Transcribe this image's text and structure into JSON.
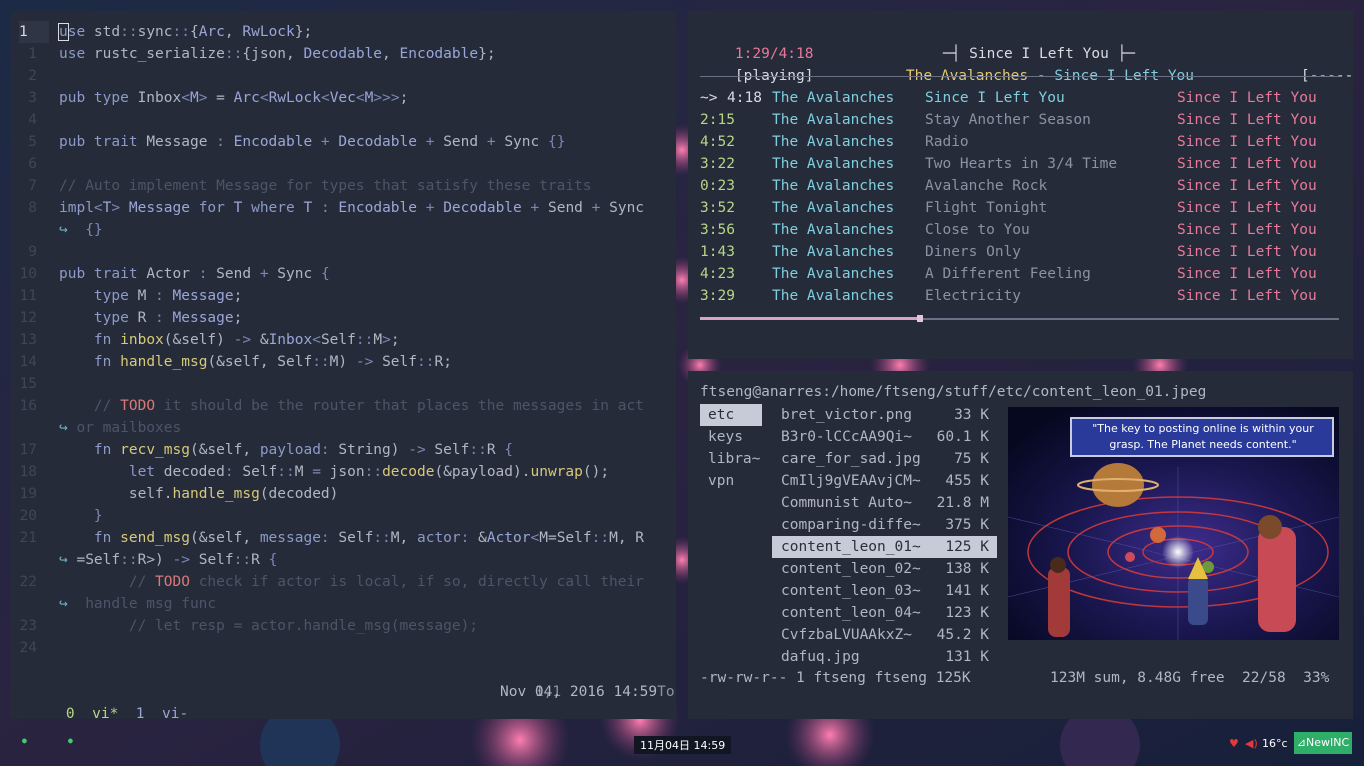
{
  "editor": {
    "lines": [
      {
        "n": "1",
        "segs": [
          [
            "kw",
            "use"
          ],
          [
            "plain",
            " std"
          ],
          [
            "op",
            "::"
          ],
          [
            "plain",
            "sync"
          ],
          [
            "op",
            "::"
          ],
          [
            "plain",
            "{"
          ],
          [
            "ty",
            "Arc"
          ],
          [
            "plain",
            ", "
          ],
          [
            "ty",
            "RwLock"
          ],
          [
            "plain",
            "};"
          ]
        ]
      },
      {
        "n": "1",
        "segs": [
          [
            "kw",
            "use"
          ],
          [
            "plain",
            " rustc_serialize"
          ],
          [
            "op",
            "::"
          ],
          [
            "plain",
            "{json, "
          ],
          [
            "ty",
            "Decodable"
          ],
          [
            "plain",
            ", "
          ],
          [
            "ty",
            "Encodable"
          ],
          [
            "plain",
            "};"
          ]
        ]
      },
      {
        "n": "2",
        "segs": []
      },
      {
        "n": "3",
        "segs": [
          [
            "kw",
            "pub type "
          ],
          [
            "plain",
            "Inbox"
          ],
          [
            "op",
            "<"
          ],
          [
            "ty",
            "M"
          ],
          [
            "op",
            ">"
          ],
          [
            "plain",
            " = "
          ],
          [
            "ty",
            "Arc"
          ],
          [
            "op",
            "<"
          ],
          [
            "ty",
            "RwLock"
          ],
          [
            "op",
            "<"
          ],
          [
            "ty",
            "Vec"
          ],
          [
            "op",
            "<"
          ],
          [
            "ty",
            "M"
          ],
          [
            "op",
            ">>>"
          ],
          [
            "plain",
            ";"
          ]
        ]
      },
      {
        "n": "4",
        "segs": []
      },
      {
        "n": "5",
        "segs": [
          [
            "kw",
            "pub trait "
          ],
          [
            "plain",
            "Message "
          ],
          [
            "op",
            ": "
          ],
          [
            "ty",
            "Encodable"
          ],
          [
            "op",
            " + "
          ],
          [
            "ty",
            "Decodable"
          ],
          [
            "op",
            " + "
          ],
          [
            "plain",
            "Send"
          ],
          [
            "op",
            " + "
          ],
          [
            "plain",
            "Sync "
          ],
          [
            "op",
            "{}"
          ]
        ]
      },
      {
        "n": "6",
        "segs": []
      },
      {
        "n": "7",
        "segs": [
          [
            "cm",
            "// Auto implement Message for types that satisfy these traits"
          ]
        ]
      },
      {
        "n": "8",
        "segs": [
          [
            "kw",
            "impl"
          ],
          [
            "op",
            "<"
          ],
          [
            "ty",
            "T"
          ],
          [
            "op",
            "> "
          ],
          [
            "ty",
            "Message "
          ],
          [
            "kw",
            "for "
          ],
          [
            "ty",
            "T "
          ],
          [
            "kw",
            "where "
          ],
          [
            "ty",
            "T "
          ],
          [
            "op",
            ": "
          ],
          [
            "ty",
            "Encodable"
          ],
          [
            "op",
            " + "
          ],
          [
            "ty",
            "Decodable"
          ],
          [
            "op",
            " + "
          ],
          [
            "plain",
            "Send"
          ],
          [
            "op",
            " + "
          ],
          [
            "plain",
            "Sync"
          ]
        ]
      },
      {
        "n": "",
        "segs": [
          [
            "wrap",
            "↪ "
          ],
          [
            "op",
            " {}"
          ]
        ]
      },
      {
        "n": "9",
        "segs": []
      },
      {
        "n": "10",
        "segs": [
          [
            "kw",
            "pub trait "
          ],
          [
            "plain",
            "Actor "
          ],
          [
            "op",
            ": "
          ],
          [
            "plain",
            "Send"
          ],
          [
            "op",
            " + "
          ],
          [
            "plain",
            "Sync "
          ],
          [
            "op",
            "{"
          ]
        ]
      },
      {
        "n": "11",
        "segs": [
          [
            "plain",
            "    "
          ],
          [
            "kw",
            "type "
          ],
          [
            "plain",
            "M "
          ],
          [
            "op",
            ": "
          ],
          [
            "ty",
            "Message"
          ],
          [
            "plain",
            ";"
          ]
        ]
      },
      {
        "n": "12",
        "segs": [
          [
            "plain",
            "    "
          ],
          [
            "kw",
            "type "
          ],
          [
            "plain",
            "R "
          ],
          [
            "op",
            ": "
          ],
          [
            "ty",
            "Message"
          ],
          [
            "plain",
            ";"
          ]
        ]
      },
      {
        "n": "13",
        "segs": [
          [
            "plain",
            "    "
          ],
          [
            "kw",
            "fn "
          ],
          [
            "fn",
            "inbox"
          ],
          [
            "plain",
            "(&self) "
          ],
          [
            "op",
            "->"
          ],
          [
            "plain",
            " &"
          ],
          [
            "ty",
            "Inbox"
          ],
          [
            "op",
            "<"
          ],
          [
            "plain",
            "Self"
          ],
          [
            "op",
            "::"
          ],
          [
            "plain",
            "M"
          ],
          [
            "op",
            ">"
          ],
          [
            "plain",
            ";"
          ]
        ]
      },
      {
        "n": "14",
        "segs": [
          [
            "plain",
            "    "
          ],
          [
            "kw",
            "fn "
          ],
          [
            "fn",
            "handle_msg"
          ],
          [
            "plain",
            "(&self, Self"
          ],
          [
            "op",
            "::"
          ],
          [
            "plain",
            "M) "
          ],
          [
            "op",
            "->"
          ],
          [
            "plain",
            " Self"
          ],
          [
            "op",
            "::"
          ],
          [
            "plain",
            "R;"
          ]
        ]
      },
      {
        "n": "15",
        "segs": []
      },
      {
        "n": "16",
        "segs": [
          [
            "plain",
            "    "
          ],
          [
            "cm",
            "// "
          ],
          [
            "todo",
            "TODO"
          ],
          [
            "cm",
            " it should be the router that places the messages in act"
          ]
        ]
      },
      {
        "n": "",
        "segs": [
          [
            "wrap",
            "↪ "
          ],
          [
            "cm",
            "or mailboxes"
          ]
        ]
      },
      {
        "n": "17",
        "segs": [
          [
            "plain",
            "    "
          ],
          [
            "kw",
            "fn "
          ],
          [
            "fn",
            "recv_msg"
          ],
          [
            "plain",
            "(&self, "
          ],
          [
            "kw",
            "payload"
          ],
          [
            "op",
            ": "
          ],
          [
            "plain",
            "String) "
          ],
          [
            "op",
            "->"
          ],
          [
            "plain",
            " Self"
          ],
          [
            "op",
            "::"
          ],
          [
            "plain",
            "R "
          ],
          [
            "op",
            "{"
          ]
        ]
      },
      {
        "n": "18",
        "segs": [
          [
            "plain",
            "        "
          ],
          [
            "kw",
            "let "
          ],
          [
            "plain",
            "decoded"
          ],
          [
            "op",
            ": "
          ],
          [
            "plain",
            "Self"
          ],
          [
            "op",
            "::"
          ],
          [
            "plain",
            "M "
          ],
          [
            "op",
            "= "
          ],
          [
            "plain",
            "json"
          ],
          [
            "op",
            "::"
          ],
          [
            "fn",
            "decode"
          ],
          [
            "plain",
            "(&payload)."
          ],
          [
            "fn",
            "unwrap"
          ],
          [
            "plain",
            "();"
          ]
        ]
      },
      {
        "n": "19",
        "segs": [
          [
            "plain",
            "        self."
          ],
          [
            "fn",
            "handle_msg"
          ],
          [
            "plain",
            "(decoded)"
          ]
        ]
      },
      {
        "n": "20",
        "segs": [
          [
            "plain",
            "    "
          ],
          [
            "op",
            "}"
          ]
        ]
      },
      {
        "n": "21",
        "segs": [
          [
            "plain",
            "    "
          ],
          [
            "kw",
            "fn "
          ],
          [
            "fn",
            "send_msg"
          ],
          [
            "plain",
            "(&self, "
          ],
          [
            "kw",
            "message"
          ],
          [
            "op",
            ": "
          ],
          [
            "plain",
            "Self"
          ],
          [
            "op",
            "::"
          ],
          [
            "plain",
            "M, "
          ],
          [
            "kw",
            "actor"
          ],
          [
            "op",
            ": "
          ],
          [
            "plain",
            "&"
          ],
          [
            "ty",
            "Actor"
          ],
          [
            "op",
            "<"
          ],
          [
            "plain",
            "M=Self"
          ],
          [
            "op",
            "::"
          ],
          [
            "plain",
            "M, R"
          ]
        ]
      },
      {
        "n": "",
        "segs": [
          [
            "wrap",
            "↪ "
          ],
          [
            "plain",
            "=Self"
          ],
          [
            "op",
            "::"
          ],
          [
            "plain",
            "R>) "
          ],
          [
            "op",
            "->"
          ],
          [
            "plain",
            " Self"
          ],
          [
            "op",
            "::"
          ],
          [
            "plain",
            "R "
          ],
          [
            "op",
            "{"
          ]
        ]
      },
      {
        "n": "22",
        "segs": [
          [
            "plain",
            "        "
          ],
          [
            "cm",
            "// "
          ],
          [
            "todo",
            "TODO"
          ],
          [
            "cm",
            " check if actor is local, if so, directly call their"
          ]
        ]
      },
      {
        "n": "",
        "segs": [
          [
            "wrap",
            "↪ "
          ],
          [
            "cm",
            " handle msg func"
          ]
        ]
      },
      {
        "n": "23",
        "segs": [
          [
            "plain",
            "        "
          ],
          [
            "cm",
            "// let resp = actor.handle_msg(message);"
          ]
        ]
      },
      {
        "n": "24",
        "segs": []
      }
    ],
    "ruler": "1,1",
    "ruler_pos": "Top",
    "tmux": {
      "win0": "0",
      "win0_name": "vi*",
      "win1": "1",
      "win1_name": "vi-"
    },
    "datetime": "Nov 04, 2016 14:59"
  },
  "music": {
    "elapsed": "1:29/4:18",
    "status": "[playing]",
    "header_title": "Since I Left You",
    "now_artist": "The Avalanches",
    "now_sep": " - ",
    "now_title": "Since I Left You",
    "flags": "[------]",
    "progress": 0.345,
    "current_marker": "~>",
    "tracks": [
      {
        "time": "4:18",
        "artist": "The Avalanches",
        "title": "Since I Left You",
        "album": "Since I Left You"
      },
      {
        "time": "2:15",
        "artist": "The Avalanches",
        "title": "Stay Another Season",
        "album": "Since I Left You"
      },
      {
        "time": "4:52",
        "artist": "The Avalanches",
        "title": "Radio",
        "album": "Since I Left You"
      },
      {
        "time": "3:22",
        "artist": "The Avalanches",
        "title": "Two Hearts in 3/4 Time",
        "album": "Since I Left You"
      },
      {
        "time": "0:23",
        "artist": "The Avalanches",
        "title": "Avalanche Rock",
        "album": "Since I Left You"
      },
      {
        "time": "3:52",
        "artist": "The Avalanches",
        "title": "Flight Tonight",
        "album": "Since I Left You"
      },
      {
        "time": "3:56",
        "artist": "The Avalanches",
        "title": "Close to You",
        "album": "Since I Left You"
      },
      {
        "time": "1:43",
        "artist": "The Avalanches",
        "title": "Diners Only",
        "album": "Since I Left You"
      },
      {
        "time": "4:23",
        "artist": "The Avalanches",
        "title": "A Different Feeling",
        "album": "Since I Left You"
      },
      {
        "time": "3:29",
        "artist": "The Avalanches",
        "title": "Electricity",
        "album": "Since I Left You"
      }
    ]
  },
  "ranger": {
    "path": "ftseng@anarres:/home/ftseng/stuff/etc/content_leon_01.jpeg",
    "parent_dirs": [
      "etc",
      "keys",
      "libra~",
      "vpn"
    ],
    "files": [
      {
        "name": "bret_victor.png",
        "size": "33 K"
      },
      {
        "name": "B3r0-lCCcAA9Qi~",
        "size": "60.1 K"
      },
      {
        "name": "care_for_sad.jpg",
        "size": "75 K"
      },
      {
        "name": "CmIlj9gVEAAvjCM~",
        "size": "455 K"
      },
      {
        "name": "Communist Auto~",
        "size": "21.8 M"
      },
      {
        "name": "comparing-diffe~",
        "size": "375 K"
      },
      {
        "name": "content_leon_01~",
        "size": "125 K"
      },
      {
        "name": "content_leon_02~",
        "size": "138 K"
      },
      {
        "name": "content_leon_03~",
        "size": "141 K"
      },
      {
        "name": "content_leon_04~",
        "size": "123 K"
      },
      {
        "name": "CvfzbaLVUAAkxZ~",
        "size": "45.2 K"
      },
      {
        "name": "dafuq.jpg",
        "size": "131 K"
      }
    ],
    "selected_index": 6,
    "preview_caption": "\"The key to posting online is within your grasp. The Planet needs content.\"",
    "status_perms": "-rw-rw-r-- 1 ftseng ftseng 125K",
    "status_sum": "123M sum, 8.48G free  22/58  33%"
  },
  "taskbar": {
    "clock": "11月04日 14:59",
    "temperature": "16°c",
    "newinc": "⊿NewINC"
  },
  "colors": {
    "pane_bg": "#252b38",
    "accent_green": "#b7d685",
    "accent_cyan": "#80cfe0",
    "accent_pink": "#e8799b",
    "accent_yellow": "#e6c86e",
    "newinc_bg": "#2fae6a"
  }
}
